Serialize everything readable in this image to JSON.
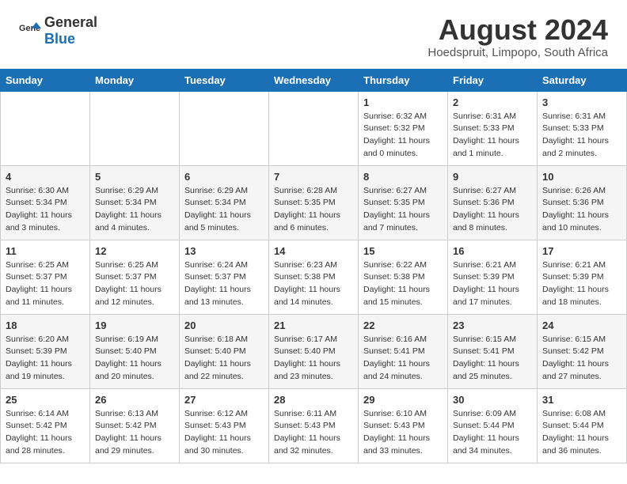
{
  "header": {
    "logo_general": "General",
    "logo_blue": "Blue",
    "main_title": "August 2024",
    "subtitle": "Hoedspruit, Limpopo, South Africa"
  },
  "weekdays": [
    "Sunday",
    "Monday",
    "Tuesday",
    "Wednesday",
    "Thursday",
    "Friday",
    "Saturday"
  ],
  "weeks": [
    [
      {
        "day": "",
        "sunrise": "",
        "sunset": "",
        "daylight": ""
      },
      {
        "day": "",
        "sunrise": "",
        "sunset": "",
        "daylight": ""
      },
      {
        "day": "",
        "sunrise": "",
        "sunset": "",
        "daylight": ""
      },
      {
        "day": "",
        "sunrise": "",
        "sunset": "",
        "daylight": ""
      },
      {
        "day": "1",
        "sunrise": "Sunrise: 6:32 AM",
        "sunset": "Sunset: 5:32 PM",
        "daylight": "Daylight: 11 hours and 0 minutes."
      },
      {
        "day": "2",
        "sunrise": "Sunrise: 6:31 AM",
        "sunset": "Sunset: 5:33 PM",
        "daylight": "Daylight: 11 hours and 1 minute."
      },
      {
        "day": "3",
        "sunrise": "Sunrise: 6:31 AM",
        "sunset": "Sunset: 5:33 PM",
        "daylight": "Daylight: 11 hours and 2 minutes."
      }
    ],
    [
      {
        "day": "4",
        "sunrise": "Sunrise: 6:30 AM",
        "sunset": "Sunset: 5:34 PM",
        "daylight": "Daylight: 11 hours and 3 minutes."
      },
      {
        "day": "5",
        "sunrise": "Sunrise: 6:29 AM",
        "sunset": "Sunset: 5:34 PM",
        "daylight": "Daylight: 11 hours and 4 minutes."
      },
      {
        "day": "6",
        "sunrise": "Sunrise: 6:29 AM",
        "sunset": "Sunset: 5:34 PM",
        "daylight": "Daylight: 11 hours and 5 minutes."
      },
      {
        "day": "7",
        "sunrise": "Sunrise: 6:28 AM",
        "sunset": "Sunset: 5:35 PM",
        "daylight": "Daylight: 11 hours and 6 minutes."
      },
      {
        "day": "8",
        "sunrise": "Sunrise: 6:27 AM",
        "sunset": "Sunset: 5:35 PM",
        "daylight": "Daylight: 11 hours and 7 minutes."
      },
      {
        "day": "9",
        "sunrise": "Sunrise: 6:27 AM",
        "sunset": "Sunset: 5:36 PM",
        "daylight": "Daylight: 11 hours and 8 minutes."
      },
      {
        "day": "10",
        "sunrise": "Sunrise: 6:26 AM",
        "sunset": "Sunset: 5:36 PM",
        "daylight": "Daylight: 11 hours and 10 minutes."
      }
    ],
    [
      {
        "day": "11",
        "sunrise": "Sunrise: 6:25 AM",
        "sunset": "Sunset: 5:37 PM",
        "daylight": "Daylight: 11 hours and 11 minutes."
      },
      {
        "day": "12",
        "sunrise": "Sunrise: 6:25 AM",
        "sunset": "Sunset: 5:37 PM",
        "daylight": "Daylight: 11 hours and 12 minutes."
      },
      {
        "day": "13",
        "sunrise": "Sunrise: 6:24 AM",
        "sunset": "Sunset: 5:37 PM",
        "daylight": "Daylight: 11 hours and 13 minutes."
      },
      {
        "day": "14",
        "sunrise": "Sunrise: 6:23 AM",
        "sunset": "Sunset: 5:38 PM",
        "daylight": "Daylight: 11 hours and 14 minutes."
      },
      {
        "day": "15",
        "sunrise": "Sunrise: 6:22 AM",
        "sunset": "Sunset: 5:38 PM",
        "daylight": "Daylight: 11 hours and 15 minutes."
      },
      {
        "day": "16",
        "sunrise": "Sunrise: 6:21 AM",
        "sunset": "Sunset: 5:39 PM",
        "daylight": "Daylight: 11 hours and 17 minutes."
      },
      {
        "day": "17",
        "sunrise": "Sunrise: 6:21 AM",
        "sunset": "Sunset: 5:39 PM",
        "daylight": "Daylight: 11 hours and 18 minutes."
      }
    ],
    [
      {
        "day": "18",
        "sunrise": "Sunrise: 6:20 AM",
        "sunset": "Sunset: 5:39 PM",
        "daylight": "Daylight: 11 hours and 19 minutes."
      },
      {
        "day": "19",
        "sunrise": "Sunrise: 6:19 AM",
        "sunset": "Sunset: 5:40 PM",
        "daylight": "Daylight: 11 hours and 20 minutes."
      },
      {
        "day": "20",
        "sunrise": "Sunrise: 6:18 AM",
        "sunset": "Sunset: 5:40 PM",
        "daylight": "Daylight: 11 hours and 22 minutes."
      },
      {
        "day": "21",
        "sunrise": "Sunrise: 6:17 AM",
        "sunset": "Sunset: 5:40 PM",
        "daylight": "Daylight: 11 hours and 23 minutes."
      },
      {
        "day": "22",
        "sunrise": "Sunrise: 6:16 AM",
        "sunset": "Sunset: 5:41 PM",
        "daylight": "Daylight: 11 hours and 24 minutes."
      },
      {
        "day": "23",
        "sunrise": "Sunrise: 6:15 AM",
        "sunset": "Sunset: 5:41 PM",
        "daylight": "Daylight: 11 hours and 25 minutes."
      },
      {
        "day": "24",
        "sunrise": "Sunrise: 6:15 AM",
        "sunset": "Sunset: 5:42 PM",
        "daylight": "Daylight: 11 hours and 27 minutes."
      }
    ],
    [
      {
        "day": "25",
        "sunrise": "Sunrise: 6:14 AM",
        "sunset": "Sunset: 5:42 PM",
        "daylight": "Daylight: 11 hours and 28 minutes."
      },
      {
        "day": "26",
        "sunrise": "Sunrise: 6:13 AM",
        "sunset": "Sunset: 5:42 PM",
        "daylight": "Daylight: 11 hours and 29 minutes."
      },
      {
        "day": "27",
        "sunrise": "Sunrise: 6:12 AM",
        "sunset": "Sunset: 5:43 PM",
        "daylight": "Daylight: 11 hours and 30 minutes."
      },
      {
        "day": "28",
        "sunrise": "Sunrise: 6:11 AM",
        "sunset": "Sunset: 5:43 PM",
        "daylight": "Daylight: 11 hours and 32 minutes."
      },
      {
        "day": "29",
        "sunrise": "Sunrise: 6:10 AM",
        "sunset": "Sunset: 5:43 PM",
        "daylight": "Daylight: 11 hours and 33 minutes."
      },
      {
        "day": "30",
        "sunrise": "Sunrise: 6:09 AM",
        "sunset": "Sunset: 5:44 PM",
        "daylight": "Daylight: 11 hours and 34 minutes."
      },
      {
        "day": "31",
        "sunrise": "Sunrise: 6:08 AM",
        "sunset": "Sunset: 5:44 PM",
        "daylight": "Daylight: 11 hours and 36 minutes."
      }
    ]
  ]
}
